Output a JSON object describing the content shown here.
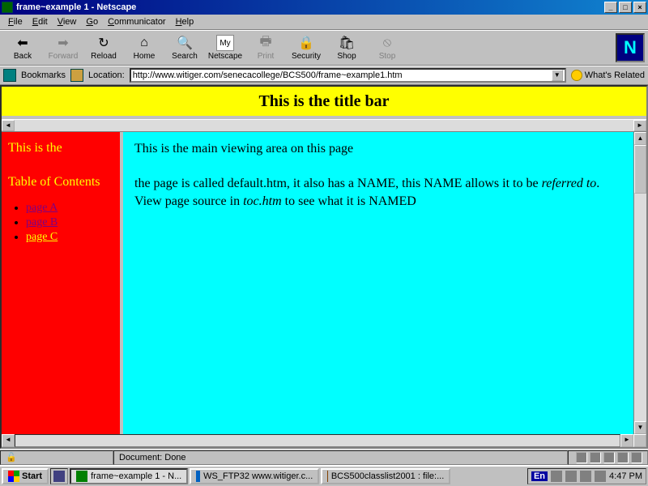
{
  "window": {
    "title": "frame~example 1 - Netscape",
    "min": "_",
    "max": "□",
    "close": "×"
  },
  "menu": {
    "file": "File",
    "edit": "Edit",
    "view": "View",
    "go": "Go",
    "communicator": "Communicator",
    "help": "Help"
  },
  "toolbar": {
    "back": "Back",
    "forward": "Forward",
    "reload": "Reload",
    "home": "Home",
    "search": "Search",
    "netscape": "Netscape",
    "print": "Print",
    "security": "Security",
    "shop": "Shop",
    "stop": "Stop"
  },
  "icons": {
    "back": "⬅",
    "forward": "➡",
    "reload": "↻",
    "home": "⌂",
    "search": "🔍",
    "netscape": "My",
    "print": "🖶",
    "security": "🔒",
    "shop": "🛍",
    "stop": "⦸",
    "brand": "N"
  },
  "location": {
    "bookmarks": "Bookmarks",
    "label": "Location:",
    "url": "http://www.witiger.com/senecacollege/BCS500/frame~example1.htm",
    "related": "What's Related"
  },
  "page": {
    "titlebar": "This is the title bar",
    "toc_head1": "This is the",
    "toc_head2": "Table of Contents",
    "links": {
      "a": "page A",
      "b": "page B",
      "c": "page C"
    },
    "main_line1": "This is the main viewing area on this page",
    "main_line2a": " the page is called default.htm, it also has a NAME, this NAME allows it to be ",
    "main_line2b": "referred to",
    "main_line2c": ". View page source in ",
    "main_line2d": "toc.htm",
    "main_line2e": " to see what it is NAMED"
  },
  "status": {
    "text": "Document: Done"
  },
  "taskbar": {
    "start": "Start",
    "task1": "frame~example 1 - N...",
    "task2": "WS_FTP32 www.witiger.c...",
    "task3": "BCS500classlist2001 : file:...",
    "lang": "En",
    "clock": "4:47 PM"
  }
}
